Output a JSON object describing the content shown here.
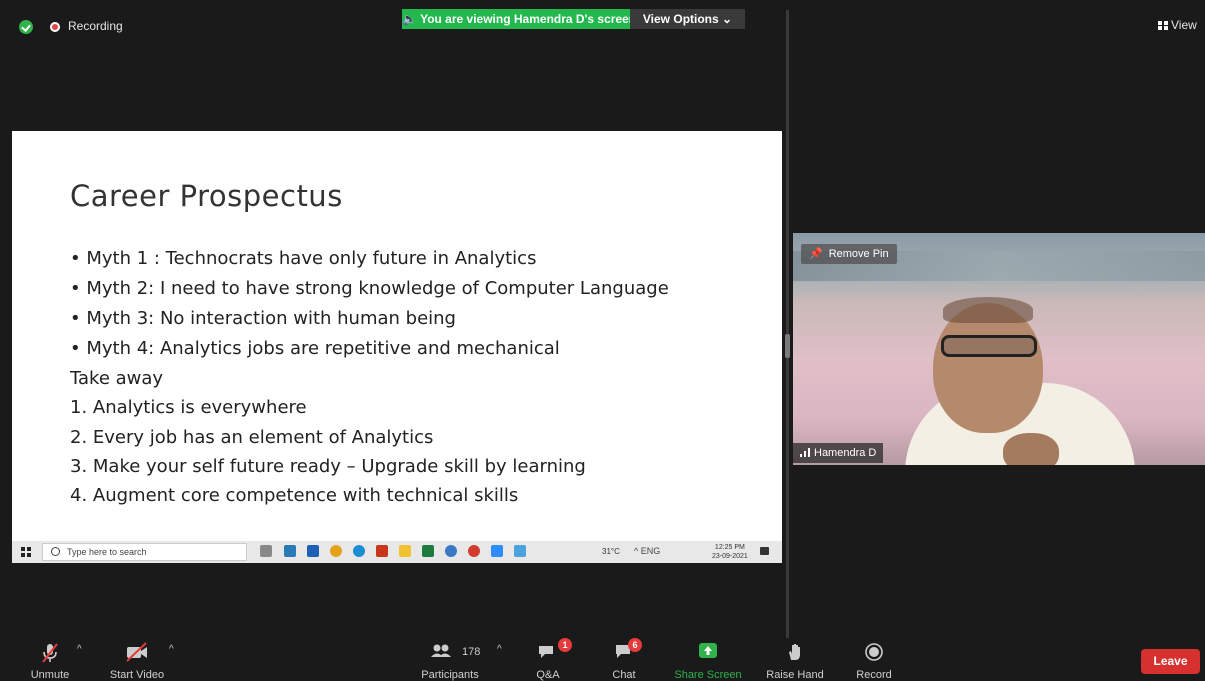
{
  "meeting": {
    "recording_label": "Recording",
    "viewing_banner": "You are viewing Hamendra D's screen",
    "view_options": "View Options",
    "view_label": "View"
  },
  "slide": {
    "title": "Career  Prospectus",
    "lines": [
      "• Myth 1 : Technocrats have only future in Analytics",
      "• Myth 2:  I need to have strong knowledge of Computer Language",
      "• Myth 3: No interaction with human being",
      "• Myth 4: Analytics jobs are repetitive and mechanical",
      "Take away",
      "1.  Analytics is everywhere",
      "2.  Every job has an element of Analytics",
      "3.   Make your self future ready – Upgrade skill by learning",
      "4.  Augment core competence with technical skills"
    ]
  },
  "shared_taskbar": {
    "search_placeholder": "Type here to search",
    "weather": "31°C",
    "tray": "^  ENG",
    "time": "12:25 PM",
    "date": "23-09-2021"
  },
  "video": {
    "remove_pin": "Remove Pin",
    "participant_name": "Hamendra D"
  },
  "toolbar": {
    "unmute": "Unmute",
    "start_video": "Start Video",
    "participants": "Participants",
    "participants_count": "178",
    "qa": "Q&A",
    "qa_badge": "1",
    "chat": "Chat",
    "chat_badge": "6",
    "share_screen": "Share Screen",
    "raise_hand": "Raise Hand",
    "record": "Record",
    "leave": "Leave"
  },
  "colors": {
    "share_green": "#2fb34a",
    "leave_red": "#d6302f",
    "badge_red": "#e53b3b",
    "banner_green": "#23b84d"
  }
}
